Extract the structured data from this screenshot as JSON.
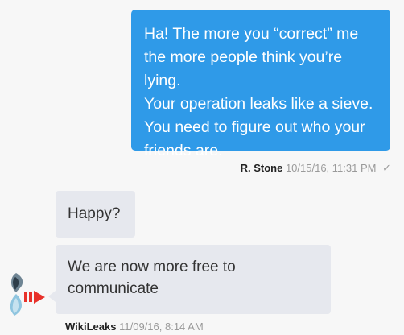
{
  "outgoing_message": {
    "lines": [
      "Ha! The more you “correct” me",
      "the more people think you’re lying.",
      "Your operation leaks like a sieve.",
      "You need to figure out who your",
      "friends are."
    ],
    "sender": "R. Stone",
    "timestamp": "10/15/16, 11:31 PM",
    "read_mark": "✓"
  },
  "incoming_messages": [
    {
      "lines": [
        "Happy?"
      ]
    },
    {
      "lines": [
        "We are now more free to",
        "communicate"
      ]
    }
  ],
  "incoming_meta": {
    "sender": "WikiLeaks",
    "timestamp": "11/09/16, 8:14 AM"
  },
  "avatar": {
    "icon": "hourglass-logo-icon"
  },
  "colors": {
    "outgoing_bubble": "#2f9ae8",
    "incoming_bubble": "#e6e8ee",
    "background": "#f7f7f7",
    "avatar_accent": "#e8312a"
  }
}
